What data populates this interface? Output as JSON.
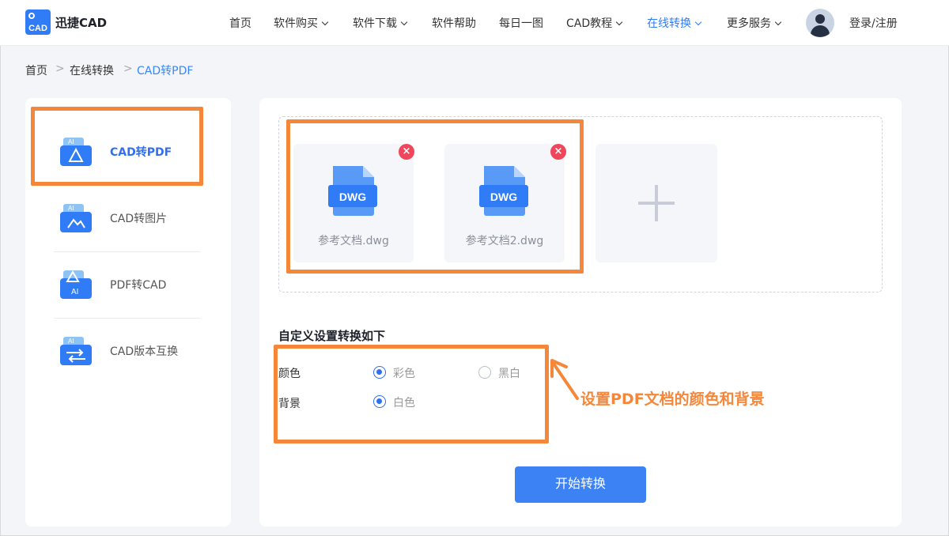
{
  "header": {
    "logo_text": "迅捷CAD",
    "logo_badge": "CAD",
    "nav": {
      "home": "首页",
      "buy": "软件购买",
      "download": "软件下载",
      "help": "软件帮助",
      "daily": "每日一图",
      "tutorial": "CAD教程",
      "online": "在线转换",
      "more": "更多服务"
    },
    "login": "登录/注册"
  },
  "breadcrumb": {
    "home": "首页",
    "section": "在线转换",
    "current": "CAD转PDF",
    "separator": ">"
  },
  "sidebar": {
    "items": [
      {
        "label": "CAD转PDF",
        "icon": "cad-to-pdf-icon",
        "active": true
      },
      {
        "label": "CAD转图片",
        "icon": "cad-to-image-icon",
        "active": false
      },
      {
        "label": "PDF转CAD",
        "icon": "pdf-to-cad-icon",
        "active": false
      },
      {
        "label": "CAD版本互换",
        "icon": "cad-version-convert-icon",
        "active": false
      }
    ]
  },
  "upload": {
    "files": [
      {
        "name": "参考文档.dwg",
        "type": "DWG"
      },
      {
        "name": "参考文档2.dwg",
        "type": "DWG"
      }
    ],
    "remove_symbol": "×"
  },
  "settings": {
    "title": "自定义设置转换如下",
    "color_label": "颜色",
    "color_options": {
      "color": "彩色",
      "bw": "黑白"
    },
    "color_selected": "彩色",
    "background_label": "背景",
    "background_options": {
      "white": "白色"
    },
    "background_selected": "白色"
  },
  "actions": {
    "start": "开始转换"
  },
  "annotation": {
    "note": "设置PDF文档的颜色和背景"
  },
  "colors": {
    "accent": "#2f6ff0",
    "highlight": "#f5873a",
    "remove": "#f0465a"
  }
}
